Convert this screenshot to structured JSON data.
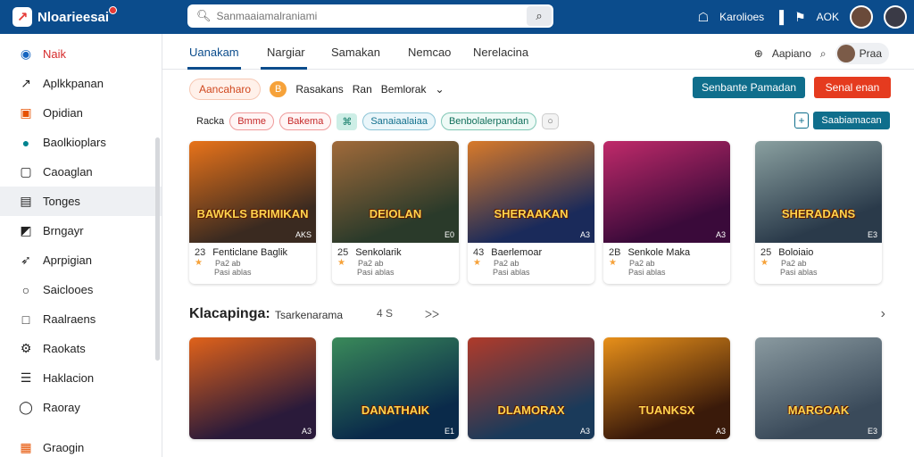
{
  "app": {
    "name": "Nloarieesai",
    "search_placeholder": "Sanmaaiamalraniami"
  },
  "topbar": {
    "store_label": "Karolioes",
    "count_label": "AOK"
  },
  "sidebar": {
    "items": [
      {
        "label": "Naik",
        "icon": "shopping-bag-icon"
      },
      {
        "label": "Aplkkpanan",
        "icon": "chart-icon"
      },
      {
        "label": "Opidian",
        "icon": "calendar-icon"
      },
      {
        "label": "Baolkioplars",
        "icon": "globe-icon"
      },
      {
        "label": "Caoaglan",
        "icon": "folder-icon"
      },
      {
        "label": "Tonges",
        "icon": "panel-icon"
      },
      {
        "label": "Brngayr",
        "icon": "image-icon"
      },
      {
        "label": "Aprpigian",
        "icon": "rocket-icon"
      },
      {
        "label": "Saiclooes",
        "icon": "circle-icon"
      },
      {
        "label": "Raalraens",
        "icon": "square-icon"
      },
      {
        "label": "Raokats",
        "icon": "gear-icon"
      },
      {
        "label": "Haklacion",
        "icon": "document-icon"
      },
      {
        "label": "Raoray",
        "icon": "ring-icon"
      },
      {
        "label": "Graogin",
        "icon": "grid-icon"
      }
    ]
  },
  "tabs": {
    "items": [
      "Uanakam",
      "Nargiar",
      "Samakan",
      "Nemcao",
      "Nerelacina"
    ],
    "right_label": "Aapiano",
    "user_label": "Praa"
  },
  "filters": {
    "pill_label": "Aancaharo",
    "badge_label": "B",
    "text1": "Rasakans",
    "text2": "Ran",
    "text3": "Bemlorak",
    "primary_button": "Senbante Pamadan",
    "danger_button": "Senal enan"
  },
  "tags": {
    "label": "Racka",
    "items": [
      "Bmme",
      "Bakema",
      "Sanaiaalaiaa",
      "Benbolalerpandan"
    ],
    "small_button": "Saabiamacan"
  },
  "row1": [
    {
      "art_title": "BAWKLS BRIMIKAN",
      "badge": "AKS",
      "num": "23",
      "name": "Fenticlane Baglik",
      "sub1": "Pa2 ab",
      "sub2": "Pasi ablas",
      "colors": [
        "#3a2a20",
        "#e8731a"
      ]
    },
    {
      "art_title": "DEIOLAN",
      "badge": "E0",
      "num": "25",
      "name": "Senkolarik",
      "sub1": "Pa2 ab",
      "sub2": "Pasi ablas",
      "colors": [
        "#2a3a2a",
        "#a06a3a"
      ]
    },
    {
      "art_title": "SHERAAKAN",
      "badge": "A3",
      "num": "43",
      "name": "Baerlemoar",
      "sub1": "Pa2 ab",
      "sub2": "Pasi ablas",
      "colors": [
        "#1a2a5a",
        "#d87a2a"
      ]
    },
    {
      "art_title": "",
      "badge": "A3",
      "num": "2B",
      "name": "Senkole Maka",
      "sub1": "Pa2 ab",
      "sub2": "Pasi ablas",
      "colors": [
        "#3a0a3a",
        "#c02a6a"
      ]
    },
    {
      "art_title": "SHERADANS",
      "badge": "E3",
      "num": "25",
      "name": "Boloiaio",
      "sub1": "Pa2 ab",
      "sub2": "Pasi ablas",
      "colors": [
        "#2a3a4a",
        "#8aa0a0"
      ]
    }
  ],
  "section": {
    "title": "Klacapinga:",
    "subtitle": "Tsarkenarama",
    "ctrl": "4 S",
    "ctrl2": "ᐳᐳ"
  },
  "row2": [
    {
      "art_title": "",
      "badge": "A3",
      "colors": [
        "#2a1a3a",
        "#e0621a"
      ]
    },
    {
      "art_title": "DANATHAIK",
      "badge": "E1",
      "colors": [
        "#0a2a4a",
        "#3a8a5a"
      ]
    },
    {
      "art_title": "DLAMORAX",
      "badge": "A3",
      "colors": [
        "#1a3a5a",
        "#b03a2a"
      ]
    },
    {
      "art_title": "TUANKSX",
      "badge": "A3",
      "colors": [
        "#3a1a0a",
        "#e8901a"
      ]
    },
    {
      "art_title": "MARGOAK",
      "badge": "E3",
      "colors": [
        "#3a4a5a",
        "#8a9aa0"
      ]
    }
  ]
}
